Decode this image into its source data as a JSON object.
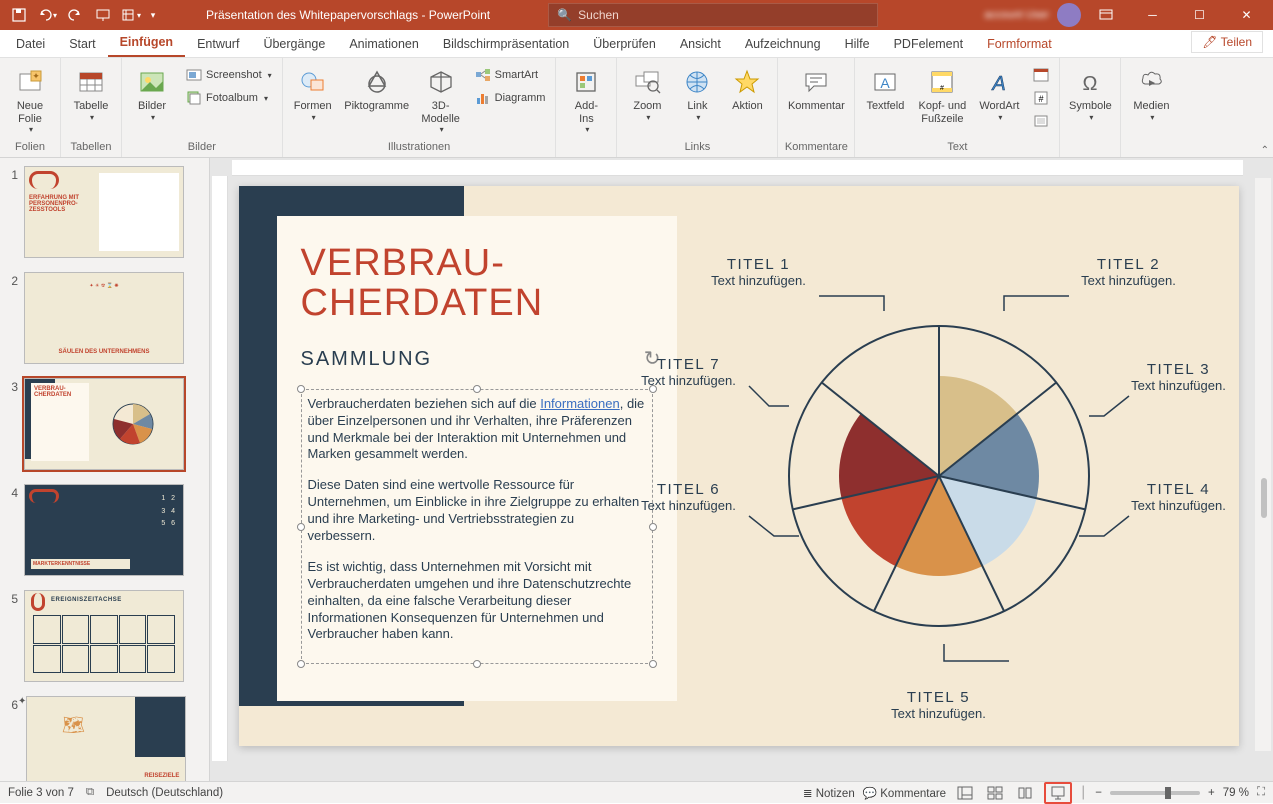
{
  "title_bar": {
    "doc_title": "Präsentation des Whitepapervorschlags  -  PowerPoint",
    "search_placeholder": "Suchen",
    "user_name": "account User"
  },
  "tabs": {
    "items": [
      "Datei",
      "Start",
      "Einfügen",
      "Entwurf",
      "Übergänge",
      "Animationen",
      "Bildschirmpräsentation",
      "Überprüfen",
      "Ansicht",
      "Aufzeichnung",
      "Hilfe",
      "PDFelement",
      "Formformat"
    ],
    "active_index": 2,
    "share": "Teilen"
  },
  "ribbon": {
    "groups": {
      "folien": {
        "label": "Folien",
        "neue_folie": "Neue\nFolie"
      },
      "tabellen": {
        "label": "Tabellen",
        "tabelle": "Tabelle"
      },
      "bilder": {
        "label": "Bilder",
        "bilder": "Bilder",
        "screenshot": "Screenshot",
        "fotoalbum": "Fotoalbum"
      },
      "illustrationen": {
        "label": "Illustrationen",
        "formen": "Formen",
        "piktogramme": "Piktogramme",
        "dreidmodelle": "3D-\nModelle",
        "smartart": "SmartArt",
        "diagramm": "Diagramm"
      },
      "addins": {
        "label": "",
        "addins": "Add-\nIns"
      },
      "links": {
        "label": "Links",
        "zoom": "Zoom",
        "link": "Link",
        "aktion": "Aktion"
      },
      "kommentare": {
        "label": "Kommentare",
        "kommentar": "Kommentar"
      },
      "text": {
        "label": "Text",
        "textfeld": "Textfeld",
        "kopfzeile": "Kopf- und\nFußzeile",
        "wordart": "WordArt"
      },
      "symbole": {
        "label": "",
        "symbole": "Symbole"
      },
      "medien": {
        "label": "",
        "medien": "Medien"
      }
    }
  },
  "thumbnails": {
    "slides": [
      {
        "num": "1",
        "title": "ERFAHRUNG MIT PERSONENPRO-ZESSTOOLS"
      },
      {
        "num": "2",
        "title": "SÄULEN DES UNTERNEHMENS"
      },
      {
        "num": "3",
        "title": "VERBRAU-CHERDATEN"
      },
      {
        "num": "4",
        "title": "MARKTERKENNTNISSE"
      },
      {
        "num": "5",
        "title": "EREIGNISZEITACHSE"
      },
      {
        "num": "6",
        "title": "REISEZIELE"
      }
    ],
    "selected_index": 2
  },
  "slide": {
    "title_line1": "VERBRAU-",
    "title_line2": "CHERDATEN",
    "subtitle": "SAMMLUNG",
    "body_p1_pre": "Verbraucherdaten beziehen sich auf die ",
    "body_p1_link": "Informationen",
    "body_p1_post": ", die über Einzelpersonen und ihr Verhalten, ihre Präferenzen und Merkmale bei der Interaktion mit Unternehmen und Marken gesammelt werden.",
    "body_p2": "Diese Daten sind eine wertvolle Ressource für Unternehmen, um Einblicke in ihre Zielgruppe zu erhalten und ihre Marketing- und Vertriebsstrategien zu verbessern.",
    "body_p3": "Es ist wichtig, dass Unternehmen mit Vorsicht mit Verbraucherdaten umgehen und ihre Datenschutzrechte einhalten, da eine falsche Verarbeitung dieser Informationen Konsequenzen für Unternehmen und Verbraucher haben kann.",
    "diagram": {
      "labels": [
        {
          "title": "TITEL 1",
          "sub": "Text hinzufügen."
        },
        {
          "title": "TITEL 2",
          "sub": "Text hinzufügen."
        },
        {
          "title": "TITEL 3",
          "sub": "Text hinzufügen."
        },
        {
          "title": "TITEL 4",
          "sub": "Text hinzufügen."
        },
        {
          "title": "TITEL 5",
          "sub": "Text hinzufügen."
        },
        {
          "title": "TITEL 6",
          "sub": "Text hinzufügen."
        },
        {
          "title": "TITEL 7",
          "sub": "Text hinzufügen."
        }
      ]
    }
  },
  "status": {
    "slide_count": "Folie 3 von 7",
    "language": "Deutsch (Deutschland)",
    "notes": "Notizen",
    "comments": "Kommentare",
    "zoom": "79 %"
  },
  "chart_data": {
    "type": "pie",
    "title": "",
    "categories": [
      "TITEL 1",
      "TITEL 2",
      "TITEL 3",
      "TITEL 4",
      "TITEL 5",
      "TITEL 6",
      "TITEL 7"
    ],
    "values": [
      1,
      1,
      1,
      1,
      1,
      1,
      1
    ],
    "colors": [
      "#d8bf8a",
      "#6e89a3",
      "#c9dbe8",
      "#d9924a",
      "#c1432e",
      "#8e2f2e",
      "#f4e9d4"
    ],
    "note": "Seven equal placeholder segments in a SmartArt cycle diagram; each segment labeled 'TITEL n' with 'Text hinzufügen.' caption."
  }
}
